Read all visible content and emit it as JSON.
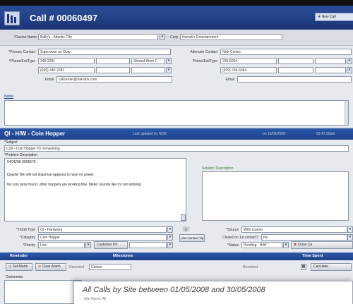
{
  "window": {
    "title": "Call # 00060497",
    "new_call_label": "New Call"
  },
  "casino": {
    "name_label": "*Casino Name",
    "name_value": "Bally's - Atlantic City",
    "corp_label": "Corp",
    "corp_value": "Harrah's Entertainment"
  },
  "contacts": {
    "primary_label": "*Primary Contact",
    "primary_value": "Supervisor on Duty",
    "phone_label": "*Phone/Ext/Type",
    "phone1": "340-2281",
    "phone1_type": "Shared Work C",
    "phone2": "(609) 340-2282",
    "email_label": "Email",
    "email_value": "callcenter@harrahs.com",
    "alt_label": "Alternate Contact",
    "alt_value": "Nick Cortes",
    "alt_phone_label": "Phone/Ext/Type",
    "alt_phone1": "236-6064",
    "alt_phone2": "(609) 236-6064",
    "alt_email_label": "Email"
  },
  "notes": {
    "label": "Notes"
  },
  "issue": {
    "title": "QI - H/W - Coin Hopper",
    "last_updated": "Last updated by NCR",
    "date": "on 13/06/2008",
    "time": "02:47:30am",
    "subject_label": "*Subject",
    "subject_value": "C28 - Coin Hopper #3 not working",
    "problem_label": "*Problem Description",
    "problem_lines": [
      "04/26/08-0095575",
      "Quarter Bin will not dispense appears to have no power.",
      "No coin jams found, other hoppers are working fine. Meter sounds like it's not working."
    ],
    "solution_label": "Solution Description"
  },
  "ticket": {
    "type_label": "*Ticket Type",
    "type_value": "QI - Hardware",
    "category_label": "*Category",
    "category_value": "Coin Hopper",
    "priority_label": "*Priority",
    "priority_value": "Low",
    "customer_pri_label": "Customer Pri:",
    "get_tip_label": "Get Contact Tip",
    "source_label": "*Source",
    "source_value": "Web Casino",
    "closed_label": "Closed on 1st contact?",
    "closed_value": "No",
    "status_label": "*Status",
    "status_value": "Pending - H/W",
    "close_label": "Close Ca"
  },
  "bottom": {
    "reminder_label": "Reminder",
    "milestones_label": "Milestones",
    "time_spent_label": "Time Spent",
    "set_alarm_label": "Set Alarm",
    "clear_alarm_label": "Clear Alarm",
    "received_label": "Received",
    "received_value": "Casino",
    "resolved_label": "Resolved",
    "calculate_label": "Calculate",
    "comments_label": "Comments"
  },
  "report": {
    "title": "All Calls by Site between 01/05/2008 and 30/05/2008",
    "subtitle": "Site Name: All"
  },
  "colors": {
    "title_bar": "#1f3f86",
    "section_bar": "#224a9a",
    "accent_red": "#c0302a"
  }
}
